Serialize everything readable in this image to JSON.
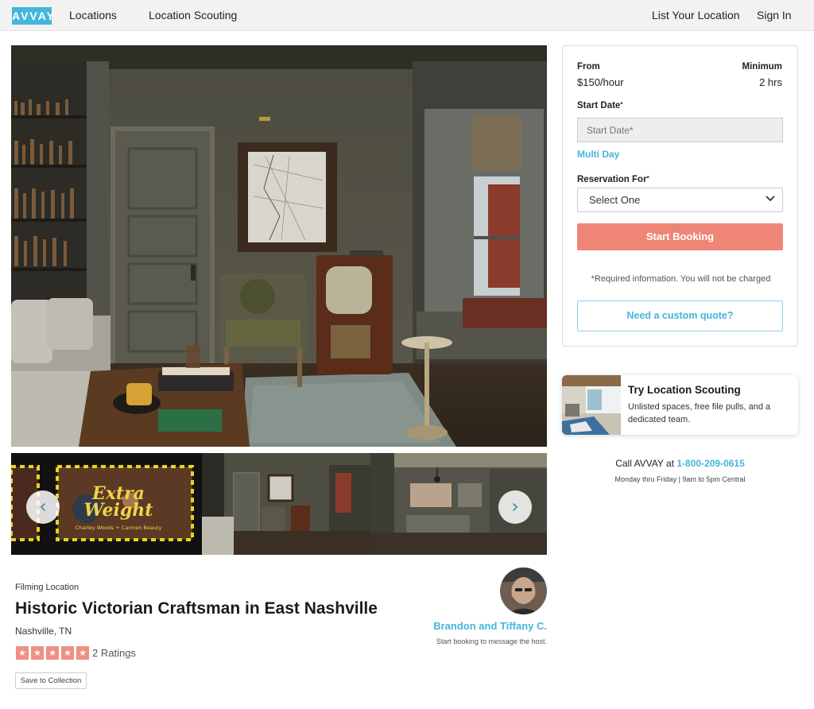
{
  "nav": {
    "logo": "AVVAY",
    "links": [
      "Locations",
      "Location Scouting"
    ],
    "right_links": [
      "List Your Location",
      "Sign In"
    ]
  },
  "gallery": {
    "prev_icon": "‹",
    "next_icon": "›",
    "thumb1_title_line1": "Extra",
    "thumb1_title_line2": "Weight",
    "thumb1_subtitle": "Charley Woods + Carmen Beauty"
  },
  "listing": {
    "category": "Filming Location",
    "title": "Historic Victorian Craftsman in East Nashville",
    "city": "Nashville, TN",
    "rating_stars": 5,
    "star_glyph": "★",
    "ratings_text": "2 Ratings",
    "save_label": "Save to Collection"
  },
  "host": {
    "name": "Brandon and Tiffany C.",
    "note": "Start booking to message the host."
  },
  "booking": {
    "from_label": "From",
    "price": "$150/hour",
    "minimum_label": "Minimum",
    "minimum_value": "2 hrs",
    "start_date_label": "Start Date",
    "required_mark": "*",
    "start_date_placeholder": "Start Date*",
    "multi_day": "Multi Day",
    "reservation_label": "Reservation For",
    "reservation_selected": "Select One",
    "start_booking": "Start Booking",
    "required_note": "*Required information. You will not be charged",
    "custom_quote": "Need a custom quote?"
  },
  "scouting": {
    "title": "Try Location Scouting",
    "description": "Unlisted spaces, free file pulls, and a dedicated team."
  },
  "contact": {
    "call_prefix": "Call AVVAY at ",
    "phone": "1-800-209-0615",
    "hours": "Monday thru Friday | 9am to 5pm Central"
  },
  "colors": {
    "brand": "#44b6d9",
    "accent": "#ee8576"
  }
}
